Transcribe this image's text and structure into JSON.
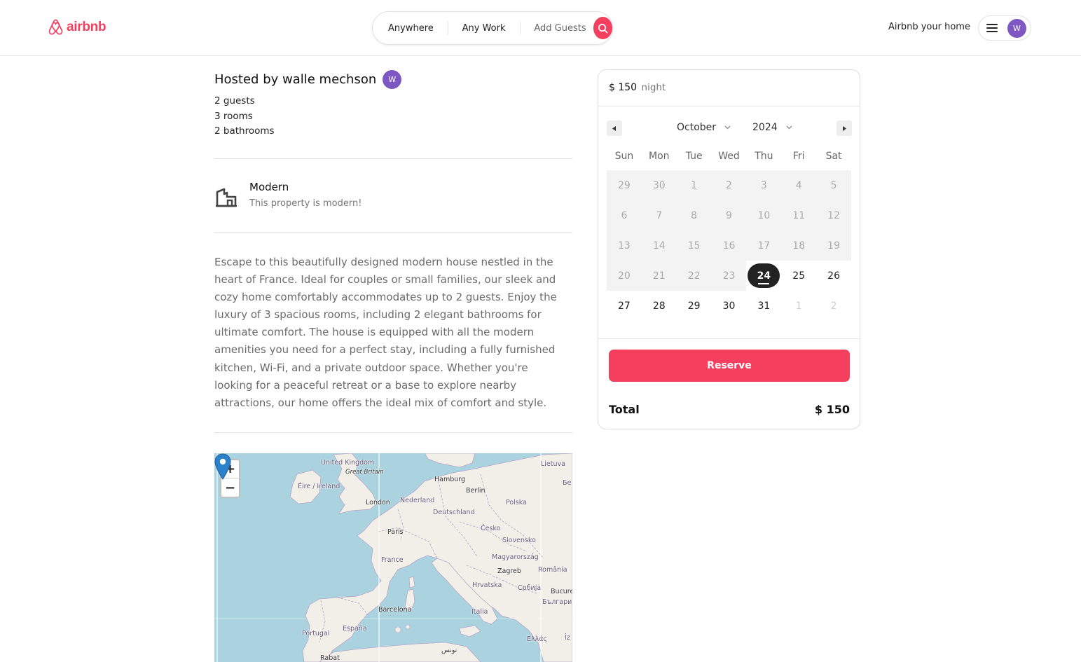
{
  "navbar": {
    "logo_text": "airbnb",
    "search": {
      "location": "Anywhere",
      "duration": "Any Work",
      "guests": "Add Guests"
    },
    "host_link": "Airbnb your home",
    "user_initial": "W"
  },
  "listing": {
    "host_title": "Hosted by walle mechson",
    "host_initial": "W",
    "guests": "2 guests",
    "rooms": "3 rooms",
    "bathrooms": "2 bathrooms",
    "category": {
      "name": "Modern",
      "description": "This property is modern!",
      "icon": "modern-house-icon"
    },
    "description": "Escape to this beautifully designed modern house nestled in the heart of France. Ideal for couples or small families, our sleek and cozy home comfortably accommodates up to 2 guests. Enjoy the luxury of 3 spacious rooms, including 2 elegant bathrooms for ultimate comfort. The house is equipped with all the modern amenities you need for a perfect stay, including a fully furnished kitchen, Wi-Fi, and a private outdoor space. Whether you're looking for a peaceful retreat or a base to explore nearby attractions, our home offers the ideal mix of comfort and style."
  },
  "map": {
    "zoom_in": "+",
    "zoom_out": "−",
    "labels": {
      "united_kingdom": "United Kingdom",
      "great_britain": "Great Britain",
      "eire": "Éire / Ireland",
      "london": "London",
      "nederland": "Nederland",
      "hamburg": "Hamburg",
      "berlin": "Berlin",
      "polska": "Polska",
      "lietuva": "Lietuva",
      "deutschland": "Deutschland",
      "paris": "Paris",
      "cesko": "Česko",
      "slovensko": "Slovensko",
      "france": "France",
      "magyarorszag": "Magyarország",
      "zagreb": "Zagreb",
      "romania": "România",
      "hrvatska": "Hrvatska",
      "srbija": "Србија",
      "bucuresti": "Bucure",
      "bulgaria": "България",
      "barcelona": "Barcelona",
      "italia": "Italia",
      "portugal": "Portugal",
      "espana": "España",
      "ellas": "Ελλάς",
      "rabat": "Rabat",
      "tunis": "تونس",
      "by": "Бе",
      "iz": "İz"
    }
  },
  "booking": {
    "price": "$ 150",
    "per": "night",
    "calendar": {
      "month": "October",
      "year": "2024",
      "weekdays": [
        "Sun",
        "Mon",
        "Tue",
        "Wed",
        "Thu",
        "Fri",
        "Sat"
      ],
      "weeks": [
        [
          "29",
          "30",
          "1",
          "2",
          "3",
          "4",
          "5"
        ],
        [
          "6",
          "7",
          "8",
          "9",
          "10",
          "11",
          "12"
        ],
        [
          "13",
          "14",
          "15",
          "16",
          "17",
          "18",
          "19"
        ],
        [
          "20",
          "21",
          "22",
          "23",
          "24",
          "25",
          "26"
        ],
        [
          "27",
          "28",
          "29",
          "30",
          "31",
          "1",
          "2"
        ]
      ],
      "today": "24"
    },
    "reserve_label": "Reserve",
    "total_label": "Total",
    "total_value": "$ 150"
  },
  "colors": {
    "brand": "#f43f5e",
    "avatar": "#7e57c2",
    "water": "#aad3df",
    "land": "#f2efe9"
  }
}
